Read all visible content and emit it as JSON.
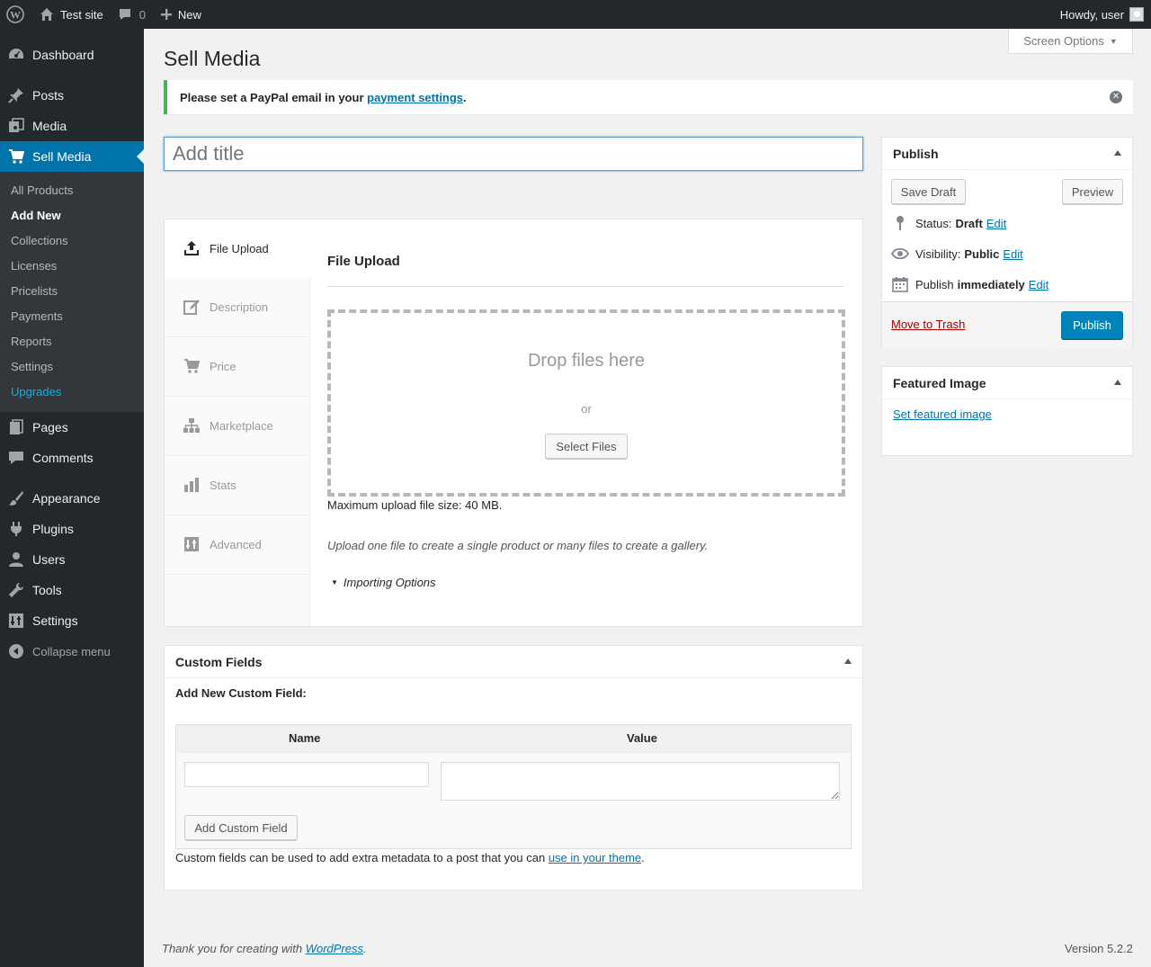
{
  "admin_bar": {
    "site_name": "Test site",
    "comments_count": "0",
    "new_label": "New",
    "howdy": "Howdy, user"
  },
  "sidebar": {
    "items": [
      {
        "label": "Dashboard",
        "icon": "dashboard-icon"
      },
      {
        "label": "Posts",
        "icon": "pin-icon"
      },
      {
        "label": "Media",
        "icon": "media-icon"
      },
      {
        "label": "Sell Media",
        "icon": "cart-icon"
      },
      {
        "label": "Pages",
        "icon": "pages-icon"
      },
      {
        "label": "Comments",
        "icon": "comment-icon"
      },
      {
        "label": "Appearance",
        "icon": "brush-icon"
      },
      {
        "label": "Plugins",
        "icon": "plugin-icon"
      },
      {
        "label": "Users",
        "icon": "user-icon"
      },
      {
        "label": "Tools",
        "icon": "wrench-icon"
      },
      {
        "label": "Settings",
        "icon": "sliders-icon"
      },
      {
        "label": "Collapse menu",
        "icon": "collapse-icon"
      }
    ],
    "submenu": [
      "All Products",
      "Add New",
      "Collections",
      "Licenses",
      "Pricelists",
      "Payments",
      "Reports",
      "Settings",
      "Upgrades"
    ]
  },
  "screen_options": "Screen Options",
  "page_title": "Sell Media",
  "notice": {
    "text": "Please set a PayPal email in your ",
    "link": "payment settings",
    "end": "."
  },
  "title_placeholder": "Add title",
  "tabs": [
    "File Upload",
    "Description",
    "Price",
    "Marketplace",
    "Stats",
    "Advanced"
  ],
  "upload": {
    "heading": "File Upload",
    "drop_text": "Drop files here",
    "or": "or",
    "select_button": "Select Files",
    "max_size": "Maximum upload file size: 40 MB.",
    "hint": "Upload one file to create a single product or many files to create a gallery.",
    "importing": "Importing Options"
  },
  "custom_fields": {
    "title": "Custom Fields",
    "subtitle": "Add New Custom Field:",
    "col_name": "Name",
    "col_value": "Value",
    "add_button": "Add Custom Field",
    "note_text": "Custom fields can be used to add extra metadata to a post that you can ",
    "note_link": "use in your theme",
    "note_end": "."
  },
  "publish": {
    "title": "Publish",
    "save_draft": "Save Draft",
    "preview": "Preview",
    "status_label": "Status:",
    "status_value": "Draft",
    "visibility_label": "Visibility:",
    "visibility_value": "Public",
    "publish_label": "Publish",
    "publish_value": "immediately",
    "edit": "Edit",
    "trash": "Move to Trash",
    "publish_button": "Publish"
  },
  "featured_image": {
    "title": "Featured Image",
    "link": "Set featured image"
  },
  "footer": {
    "thanks": "Thank you for creating with ",
    "wp_link": "WordPress",
    "thanks_end": ".",
    "version": "Version 5.2.2"
  },
  "colors": {
    "admin_bar": "#23282d",
    "accent": "#0073aa",
    "notice_success": "#46b450",
    "trash": "#a00000"
  }
}
